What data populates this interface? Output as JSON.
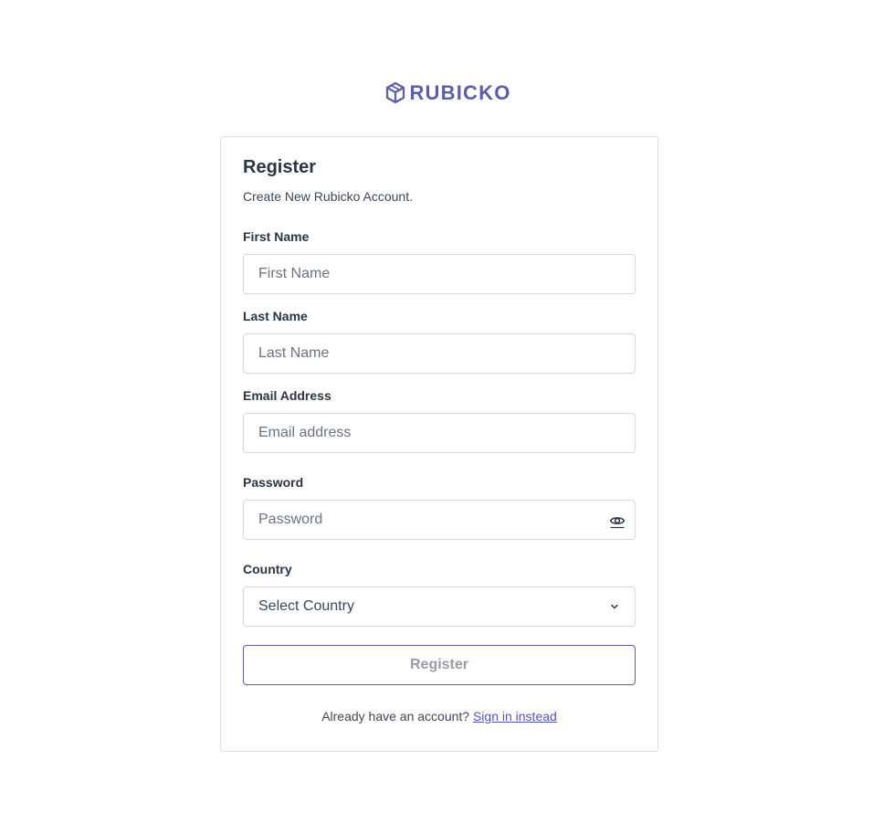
{
  "brand": {
    "name": "RUBICKO",
    "color": "#5a5fa8",
    "icon": "cube-logo-icon"
  },
  "form": {
    "title": "Register",
    "subtitle": "Create New Rubicko Account.",
    "first_name": {
      "label": "First Name",
      "placeholder": "First Name",
      "value": ""
    },
    "last_name": {
      "label": "Last Name",
      "placeholder": "Last Name",
      "value": ""
    },
    "email": {
      "label": "Email Address",
      "placeholder": "Email address",
      "value": ""
    },
    "password": {
      "label": "Password",
      "placeholder": "Password",
      "value": "",
      "toggle_icon": "eye-icon"
    },
    "country": {
      "label": "Country",
      "selected": "Select Country",
      "icon": "chevron-down-icon"
    },
    "submit_label": "Register"
  },
  "footer": {
    "prompt": "Already have an account?",
    "link": "Sign in instead"
  },
  "colors": {
    "accent": "#5a5fa8",
    "link": "#4d58b6",
    "border": "#d4d7dd",
    "text": "#2b3544"
  }
}
